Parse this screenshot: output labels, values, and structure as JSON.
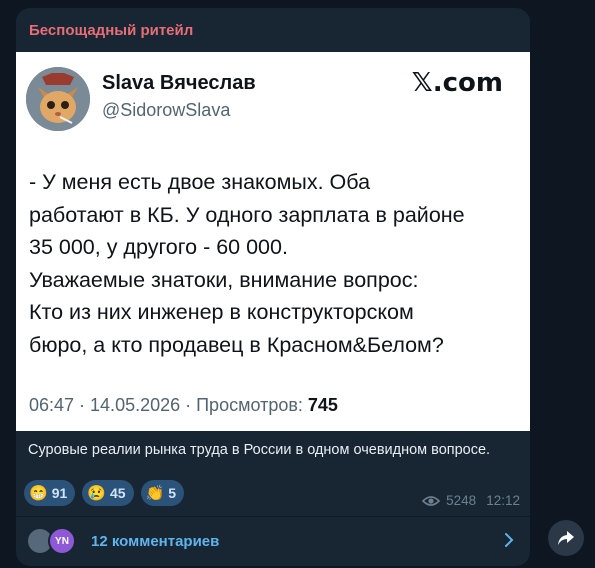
{
  "channel": {
    "name": "Беспощадный ритейл"
  },
  "tweet": {
    "author_name": "Slava Вячеслав",
    "author_handle": "@SidorowSlava",
    "brand": "𝕏.com",
    "lines": [
      "- У меня есть двое знакомых. Оба",
      "работают в КБ. У одного зарплата в районе",
      "35 000, у другого - 60 000.",
      "Уважаемые знатоки, внимание вопрос:",
      "Кто из них инженер в конструкторском",
      "бюро, а кто продавец в Красном&Белом?"
    ],
    "meta": "06:47 · 14.05.2026 · Просмотров: ",
    "views": "745"
  },
  "caption": "Суровые реалии рынка труда в России в одном очевидном вопросе.",
  "reactions": [
    {
      "emoji": "😁",
      "icon": "grin-emoji",
      "count": "91"
    },
    {
      "emoji": "😢",
      "icon": "cry-emoji",
      "count": "45"
    },
    {
      "emoji": "👏",
      "icon": "clap-emoji",
      "count": "5"
    }
  ],
  "views": "5248",
  "time": "12:12",
  "comments": {
    "label": "12 комментариев",
    "avatar_initials": "YN"
  },
  "colors": {
    "channel": "#e96d76",
    "link": "#5fb4ee",
    "bubble": "#182533",
    "background": "#0e1621"
  }
}
